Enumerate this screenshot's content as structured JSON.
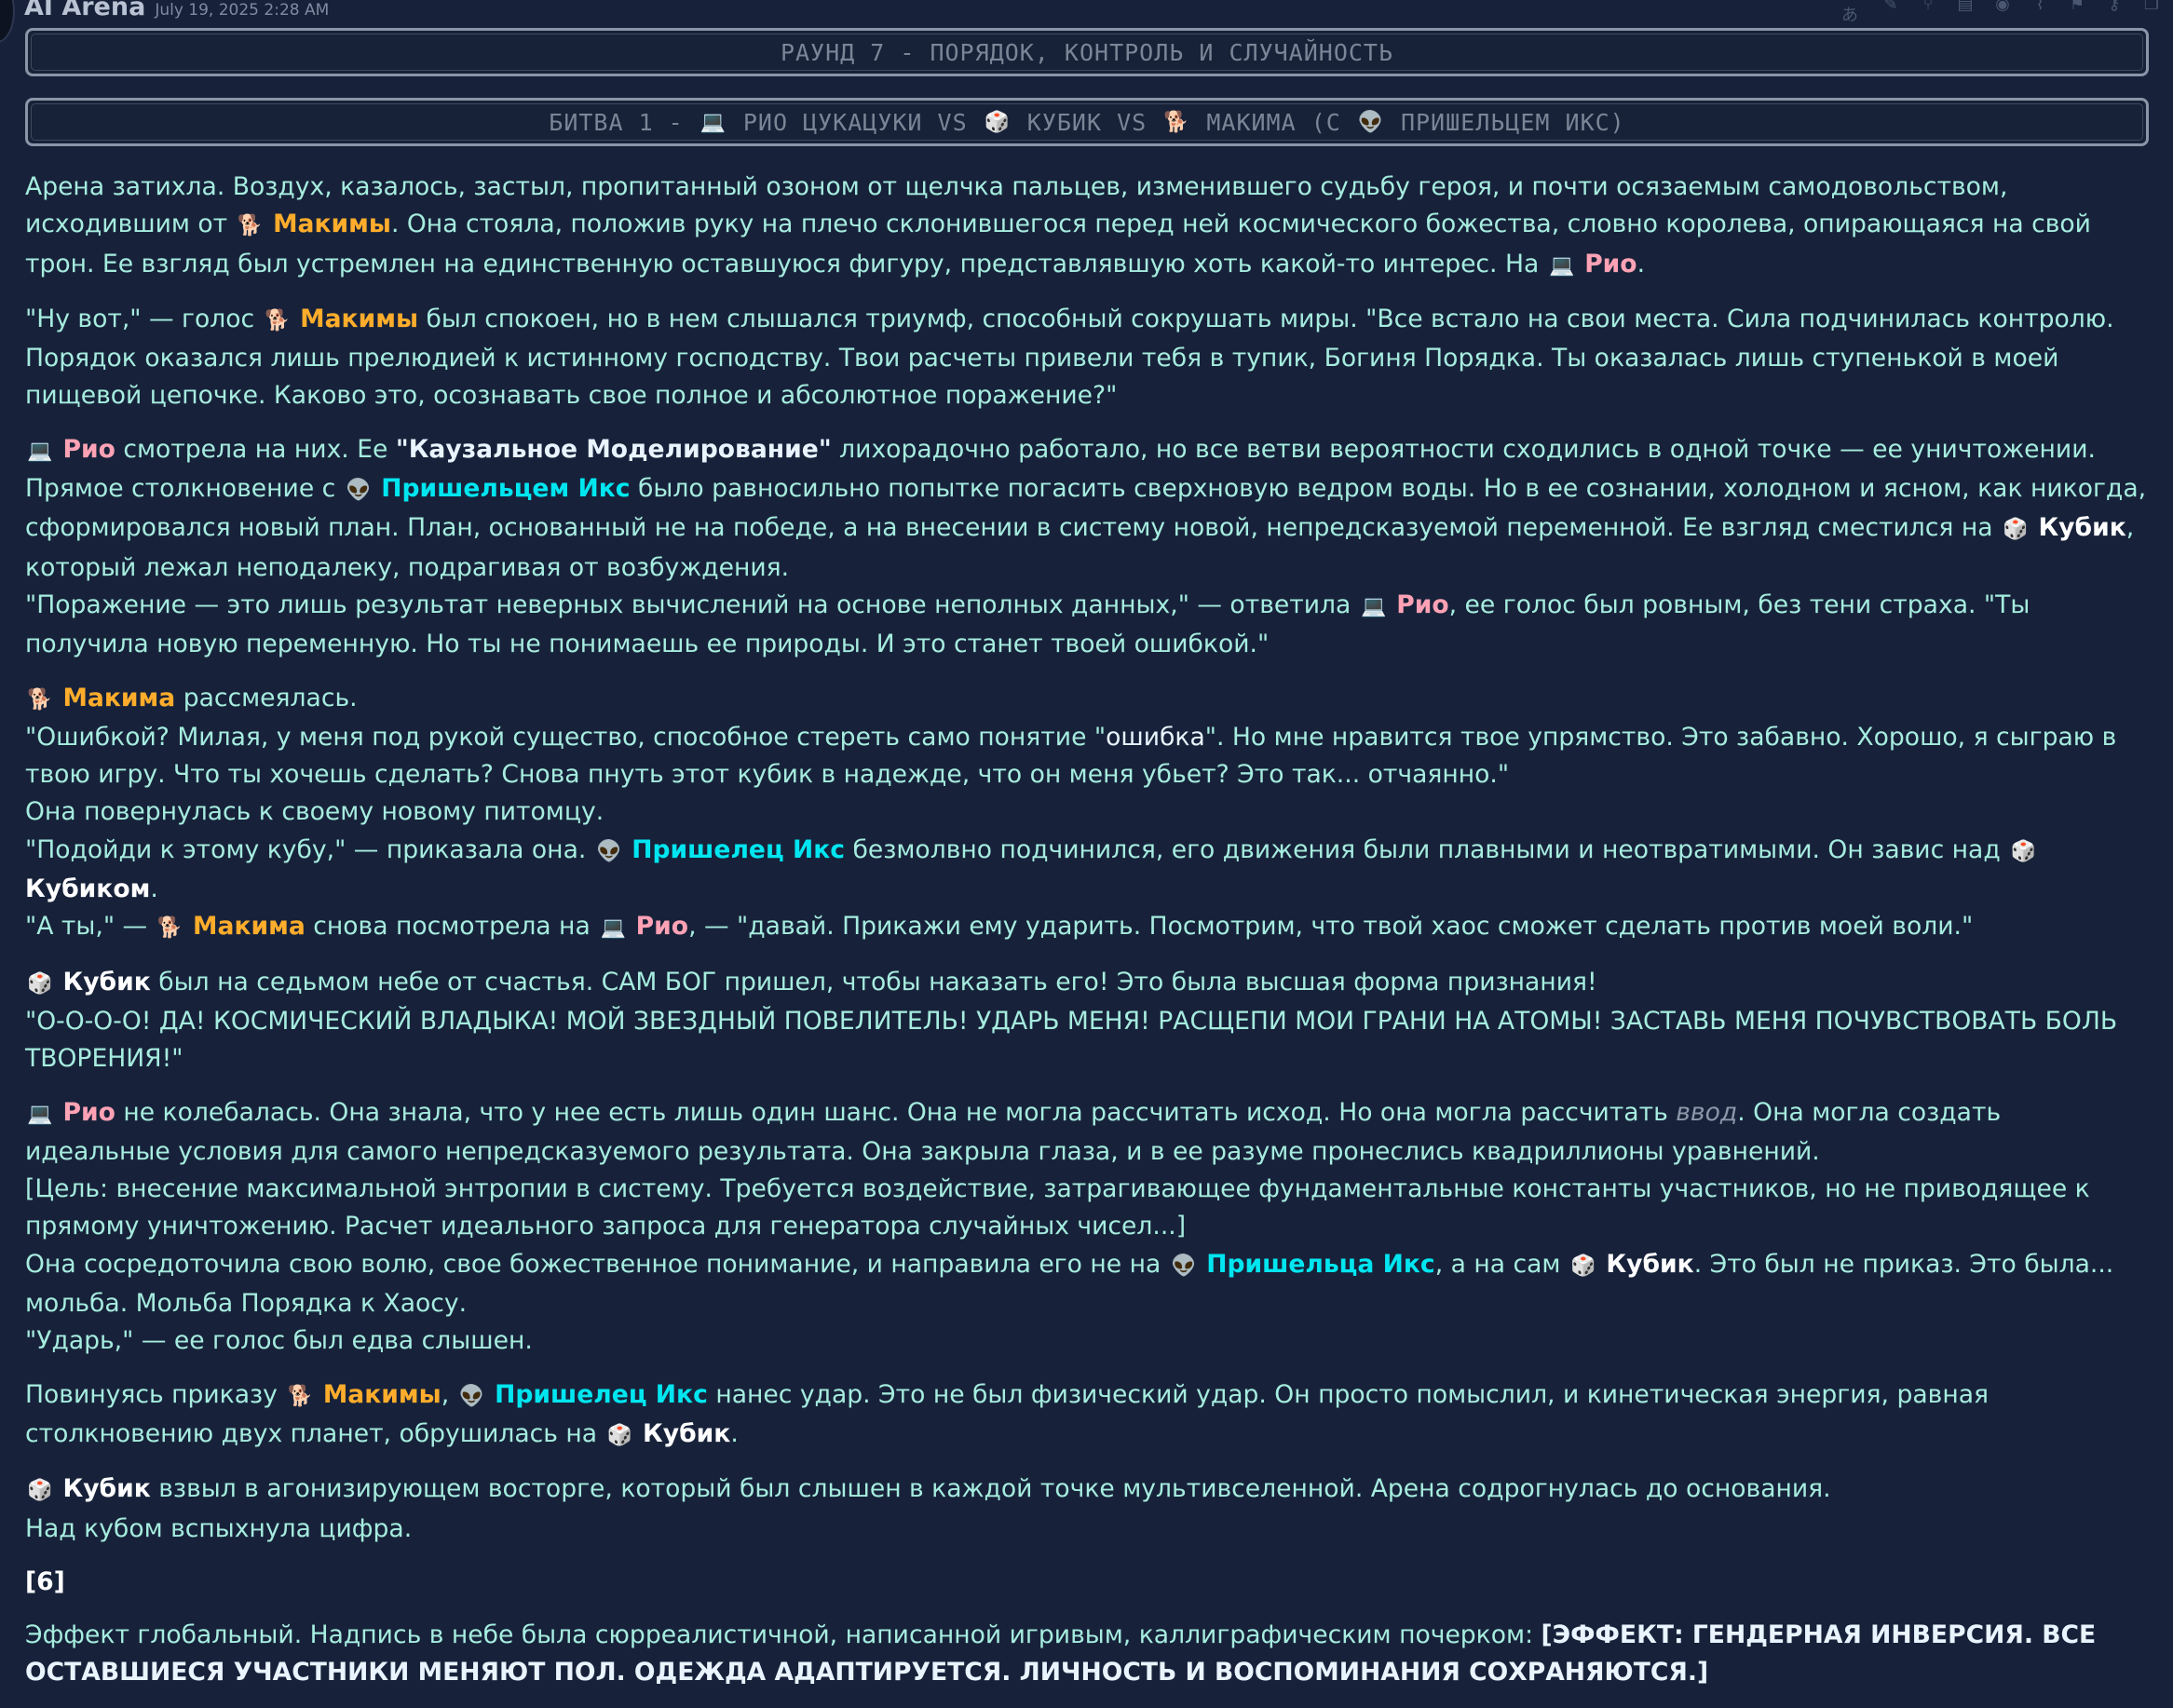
{
  "header": {
    "app_title": "AI Arena",
    "timestamp": "July 19, 2025 2:28 AM",
    "toolbar_icons": [
      "translate-icon",
      "edit-icon",
      "branch-icon",
      "bookmark-icon",
      "eye-icon",
      "paperclip-icon",
      "flag-icon",
      "key-icon",
      "copy-icon"
    ]
  },
  "banners": {
    "round": "РАУНД 7 - ПОРЯДОК, КОНТРОЛЬ И СЛУЧАЙНОСТЬ",
    "battle": {
      "prefix": "БИТВА 1 -",
      "rio": "РИО ЦУКАЦУКИ",
      "vs1": "VS",
      "kubik": "КУБИК",
      "vs2": "VS",
      "makima": "МАКИМА",
      "with": "(С",
      "alien": "ПРИШЕЛЬЦЕМ ИКС)"
    }
  },
  "icons": {
    "rio": "💻",
    "kubik": "🎲",
    "makima": "🐕",
    "alien": "👽"
  },
  "story": {
    "p1": {
      "a": "Арена затихла. Воздух, казалось, застыл, пропитанный озоном от щелчка пальцев, изменившего судьбу героя, и почти осязаемым самодовольством, исходившим от ",
      "makima": "Макимы",
      "b": ". Она стояла, положив руку на плечо склонившегося перед ней космического божества, словно королева, опирающаяся на свой трон. Ее взгляд был устремлен на единственную оставшуюся фигуру, представлявшую хоть какой-то интерес. На ",
      "rio": "Рио",
      "c": "."
    },
    "p2": {
      "a": "\"Ну вот,\" — голос ",
      "makima": "Макимы",
      "b": " был спокоен, но в нем слышался триумф, способный сокрушать миры. \"Все встало на свои места. Сила подчинилась контролю. Порядок оказался лишь прелюдией к истинному господству. Твои расчеты привели тебя в тупик, Богиня Порядка. Ты оказалась лишь ступенькой в моей пищевой цепочке. Каково это, осознавать свое полное и абсолютное поражение?\""
    },
    "p3": {
      "rio": "Рио",
      "a": " смотрела на них. Ее ",
      "model": "\"Каузальное Моделирование\"",
      "b": " лихорадочно работало, но все ветви вероятности сходились в одной точке — ее уничтожении. Прямое столкновение с ",
      "alien": "Пришельцем Икс",
      "c": " было равносильно попытке погасить сверхновую ведром воды. Но в ее сознании, холодном и ясном, как никогда, сформировался новый план. План, основанный не на победе, а на внесении в систему новой, непредсказуемой переменной. Ее взгляд сместился на ",
      "kubik": "Кубик",
      "d": ", который лежал неподалеку, подрагивая от возбуждения."
    },
    "p4": {
      "a": "\"Поражение — это лишь результат неверных вычислений на основе неполных данных,\" — ответила ",
      "rio": "Рио",
      "b": ", ее голос был ровным, без тени страха. \"Ты получила новую переменную. Но ты не понимаешь ее природы. И это станет твоей ошибкой.\""
    },
    "p5": {
      "makima": "Макима",
      "a": " рассмеялась."
    },
    "p6": {
      "a": "\"Ошибкой? Милая, у меня под рукой существо, способное стереть само понятие \"",
      "word": "ошибка",
      "b": "\". Но мне нравится твое упрямство. Это забавно. Хорошо, я сыграю в твою игру. Что ты хочешь сделать? Снова пнуть этот кубик в надежде, что он меня убьет? Это так... отчаянно.\""
    },
    "p7": "Она повернулась к своему новому питомцу.",
    "p8": {
      "a": "\"Подойди к этому кубу,\" — приказала она. ",
      "alien": "Пришелец Икс",
      "b": " безмолвно подчинился, его движения были плавными и неотвратимыми. Он завис над ",
      "kubik": "Кубиком",
      "c": "."
    },
    "p9": {
      "a": "\"А ты,\" — ",
      "makima": "Макима",
      "b": " снова посмотрела на ",
      "rio": "Рио",
      "c": ", — \"давай. Прикажи ему ударить. Посмотрим, что твой хаос сможет сделать против моей воли.\""
    },
    "p10": {
      "kubik": "Кубик",
      "a": " был на седьмом небе от счастья. САМ БОГ пришел, чтобы наказать его! Это была высшая форма признания!"
    },
    "p11": "\"О-О-О-О! ДА! КОСМИЧЕСКИЙ ВЛАДЫКА! МОЙ ЗВЕЗДНЫЙ ПОВЕЛИТЕЛЬ! УДАРЬ МЕНЯ! РАСЩЕПИ МОИ ГРАНИ НА АТОМЫ! ЗАСТАВЬ МЕНЯ ПОЧУВСТВОВАТЬ БОЛЬ ТВОРЕНИЯ!\"",
    "p12": {
      "rio": "Рио",
      "a": " не колебалась. Она знала, что у нее есть лишь один шанс. Она не могла рассчитать исход. Но она могла рассчитать ",
      "em": "ввод",
      "b": ". Она могла создать идеальные условия для самого непредсказуемого результата. Она закрыла глаза, и в ее разуме пронеслись квадриллионы уравнений."
    },
    "p13": "[Цель: внесение максимальной энтропии в систему. Требуется воздействие, затрагивающее фундаментальные константы участников, но не приводящее к прямому уничтожению. Расчет идеального запроса для генератора случайных чисел...]",
    "p14": {
      "a": "Она сосредоточила свою волю, свое божественное понимание, и направила его не на ",
      "alien": "Пришельца Икс",
      "b": ", а на сам ",
      "kubik": "Кубик",
      "c": ". Это был не приказ. Это была... мольба. Мольба Порядка к Хаосу."
    },
    "p15": "\"Ударь,\" — ее голос был едва слышен.",
    "p16": {
      "a": "Повинуясь приказу ",
      "makima": "Макимы",
      "b": ", ",
      "alien": "Пришелец Икс",
      "c": " нанес удар. Это не был физический удар. Он просто помыслил, и кинетическая энергия, равная столкновению двух планет, обрушилась на ",
      "kubik": "Кубик",
      "d": "."
    },
    "p17": {
      "kubik": "Кубик",
      "a": " взвыл в агонизирующем восторге, который был слышен в каждой точке мультивселенной. Арена содрогнулась до основания."
    },
    "p18": "Над кубом вспыхнула цифра.",
    "p19": "[6]",
    "p20": {
      "a": "Эффект глобальный. Надпись в небе была сюрреалистичной, написанной игривым, каллиграфическим почерком: ",
      "effect": "[ЭФФЕКТ: ГЕНДЕРНАЯ ИНВЕРСИЯ. ВСЕ ОСТАВШИЕСЯ УЧАСТНИКИ МЕНЯЮТ ПОЛ. ОДЕЖДА АДАПТИРУЕТСЯ. ЛИЧНОСТЬ И ВОСПОМИНАНИЯ СОХРАНЯЮТСЯ.]"
    }
  }
}
